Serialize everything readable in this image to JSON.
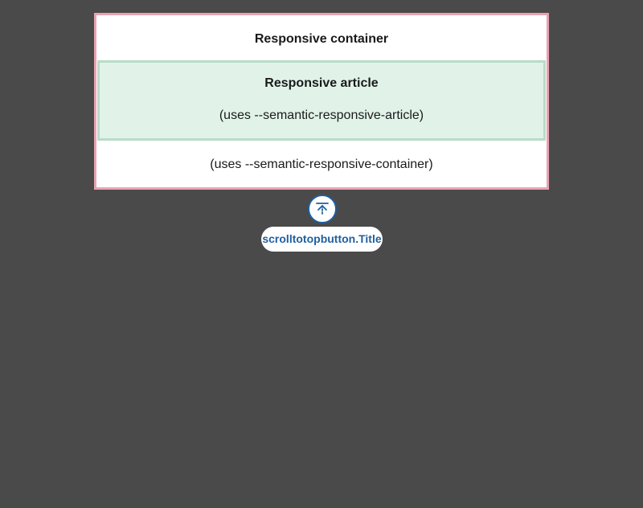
{
  "container": {
    "title": "Responsive container",
    "note": "(uses --semantic-responsive-container)",
    "border_color": "#e8a3b1",
    "background": "#ffffff"
  },
  "article": {
    "title": "Responsive article",
    "note": "(uses --semantic-responsive-article)",
    "border_color": "#b8dcc7",
    "background": "#e1f3e9"
  },
  "scroll_to_top": {
    "icon": "arrow-up-to-line-icon",
    "tooltip": "scrolltotopbutton.Title",
    "accent_color": "#1f5f9f"
  },
  "page": {
    "background": "#4a4a4a"
  }
}
